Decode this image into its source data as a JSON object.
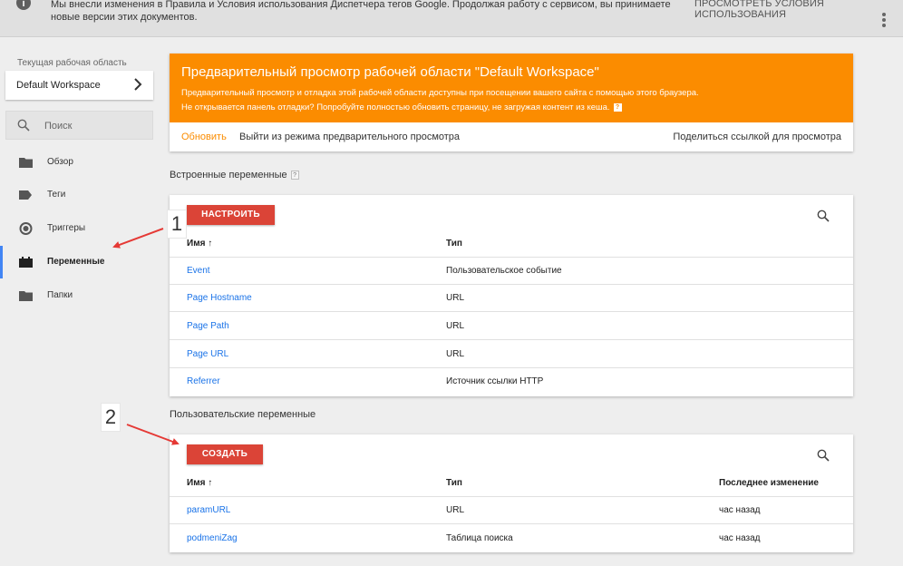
{
  "notice": {
    "message": "Мы внесли изменения в Правила и Условия использования Диспетчера тегов Google. Продолжая работу с сервисом, вы принимаете новые версии этих документов.",
    "terms_link": "ПРОСМОТРЕТЬ УСЛОВИЯ ИСПОЛЬЗОВАНИЯ",
    "info_glyph": "i"
  },
  "sidebar": {
    "workspace_label": "Текущая рабочая область",
    "workspace_name": "Default Workspace",
    "search_placeholder": "Поиск",
    "items": [
      {
        "label": "Обзор",
        "icon": "folder-icon"
      },
      {
        "label": "Теги",
        "icon": "tag-icon"
      },
      {
        "label": "Триггеры",
        "icon": "trigger-icon"
      },
      {
        "label": "Переменные",
        "icon": "variables-icon",
        "active": true
      },
      {
        "label": "Папки",
        "icon": "folder-icon"
      }
    ]
  },
  "preview": {
    "title": "Предварительный просмотр рабочей области \"Default Workspace\"",
    "line1": "Предварительный просмотр и отладка этой рабочей области доступны при посещении вашего сайта с помощью этого браузера.",
    "line2": "Не открывается панель отладки? Попробуйте полностью обновить страницу, не загружая контент из кеша.",
    "help_glyph": "?",
    "refresh": "Обновить",
    "exit": "Выйти из режима предварительного просмотра",
    "share": "Поделиться ссылкой для просмотра",
    "color": "#fb8c00"
  },
  "builtin": {
    "title": "Встроенные переменные",
    "help_glyph": "?",
    "button": "НАСТРОИТЬ",
    "col_name": "Имя ↑",
    "col_type": "Тип",
    "rows": [
      {
        "name": "Event",
        "type": "Пользовательское событие"
      },
      {
        "name": "Page Hostname",
        "type": "URL"
      },
      {
        "name": "Page Path",
        "type": "URL"
      },
      {
        "name": "Page URL",
        "type": "URL"
      },
      {
        "name": "Referrer",
        "type": "Источник ссылки HTTP"
      }
    ]
  },
  "custom": {
    "title": "Пользовательские переменные",
    "button": "СОЗДАТЬ",
    "col_name": "Имя ↑",
    "col_type": "Тип",
    "col_modified": "Последнее изменение",
    "rows": [
      {
        "name": "paramURL",
        "type": "URL",
        "modified": "час назад"
      },
      {
        "name": "podmeniZag",
        "type": "Таблица поиска",
        "modified": "час назад"
      }
    ]
  },
  "annotations": {
    "one": "1",
    "two": "2",
    "arrow_color": "#e53935"
  },
  "colors": {
    "accent_red": "#db4437",
    "link_blue": "#1a73e8",
    "active_blue": "#4285f4"
  }
}
